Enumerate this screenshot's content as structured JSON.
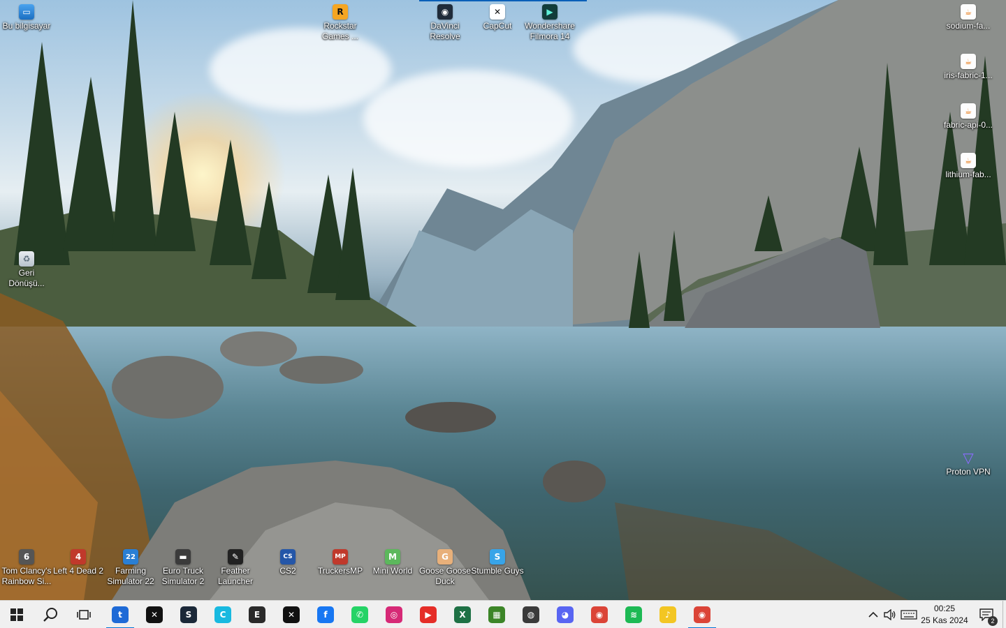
{
  "desktop": {
    "left_icons": [
      {
        "label": "Bu bilgisayar",
        "icon": "computer-icon"
      },
      {
        "label": "Geri Dönüşü...",
        "icon": "recycle-bin-icon"
      }
    ],
    "top_icons": [
      {
        "label": "Rockstar Games ...",
        "icon": "rockstar-icon",
        "color": "#f5a623",
        "glyph": "R"
      },
      {
        "label": "DaVinci Resolve",
        "icon": "davinci-resolve-icon",
        "color": "#1f2b3a",
        "glyph": "◉"
      },
      {
        "label": "CapCut",
        "icon": "capcut-icon",
        "color": "#111111",
        "glyph": "✕"
      },
      {
        "label": "Wondershare Filmora 14",
        "icon": "filmora-icon",
        "color": "#123c3a",
        "glyph": "▶"
      }
    ],
    "right_icons": [
      {
        "label": "sodium-fa...",
        "icon": "java-file-icon"
      },
      {
        "label": "iris-fabric-1...",
        "icon": "java-file-icon"
      },
      {
        "label": "fabric-api-0...",
        "icon": "java-file-icon"
      },
      {
        "label": "lithium-fab...",
        "icon": "java-file-icon"
      }
    ],
    "proton": {
      "label": "Proton VPN",
      "icon": "proton-vpn-icon",
      "color": "#6d4aff",
      "glyph": "▽"
    },
    "bottom_icons": [
      {
        "label": "Tom Clancy's Rainbow Si...",
        "icon": "rainbow-six-icon",
        "color": "#555555",
        "glyph": "6"
      },
      {
        "label": "Left 4 Dead 2",
        "icon": "left4dead2-icon",
        "color": "#c0392b",
        "glyph": "4"
      },
      {
        "label": "Farming Simulator 22",
        "icon": "farming-simulator-icon",
        "color": "#2a7fd4",
        "glyph": "22"
      },
      {
        "label": "Euro Truck Simulator 2",
        "icon": "euro-truck-icon",
        "color": "#3b3b3b",
        "glyph": "▬"
      },
      {
        "label": "Feather Launcher",
        "icon": "feather-launcher-icon",
        "color": "#222222",
        "glyph": "✎"
      },
      {
        "label": "CS2",
        "icon": "cs2-icon",
        "color": "#2456a8",
        "glyph": "CS"
      },
      {
        "label": "TruckersMP",
        "icon": "truckersmp-icon",
        "color": "#c0392b",
        "glyph": "MP"
      },
      {
        "label": "Mini World",
        "icon": "mini-world-icon",
        "color": "#5cb85c",
        "glyph": "M"
      },
      {
        "label": "Goose Goose Duck",
        "icon": "goose-goose-duck-icon",
        "color": "#e8b07a",
        "glyph": "G"
      },
      {
        "label": "Stumble Guys",
        "icon": "stumble-guys-icon",
        "color": "#38a4e8",
        "glyph": "S"
      }
    ]
  },
  "taskbar": {
    "start": {
      "icon": "windows-start-icon"
    },
    "search": {
      "icon": "search-icon"
    },
    "task_view": {
      "icon": "task-view-icon"
    },
    "apps": [
      {
        "name": "tlauncher-icon",
        "color": "#1e6ad6",
        "glyph": "t",
        "running": true
      },
      {
        "name": "capcut-icon",
        "color": "#111111",
        "glyph": "✕",
        "running": false
      },
      {
        "name": "steam-icon",
        "color": "#1b2838",
        "glyph": "S",
        "running": false
      },
      {
        "name": "canva-icon",
        "color": "#18b9e0",
        "glyph": "C",
        "running": false
      },
      {
        "name": "epic-games-icon",
        "color": "#2a2a2a",
        "glyph": "E",
        "running": false
      },
      {
        "name": "capcut-alt-icon",
        "color": "#111111",
        "glyph": "✕",
        "running": false
      },
      {
        "name": "facebook-icon",
        "color": "#1877f2",
        "glyph": "f",
        "running": false
      },
      {
        "name": "whatsapp-icon",
        "color": "#25d366",
        "glyph": "✆",
        "running": false
      },
      {
        "name": "instagram-icon",
        "color": "#d62976",
        "glyph": "◎",
        "running": false
      },
      {
        "name": "youtube-icon",
        "color": "#e52d27",
        "glyph": "▶",
        "running": false
      },
      {
        "name": "excel-icon",
        "color": "#1e7145",
        "glyph": "X",
        "running": false
      },
      {
        "name": "minecraft-icon",
        "color": "#3c8527",
        "glyph": "▦",
        "running": false
      },
      {
        "name": "obs-icon",
        "color": "#3a3a3a",
        "glyph": "◍",
        "running": false
      },
      {
        "name": "discord-icon",
        "color": "#5865f2",
        "glyph": "◕",
        "running": false
      },
      {
        "name": "chrome-icon",
        "color": "#db4437",
        "glyph": "◉",
        "running": false
      },
      {
        "name": "spotify-icon",
        "color": "#1db954",
        "glyph": "≋",
        "running": false
      },
      {
        "name": "karaoke-icon",
        "color": "#f3c623",
        "glyph": "♪",
        "running": false
      },
      {
        "name": "chrome-profile-icon",
        "color": "#db4437",
        "glyph": "◉",
        "running": true
      }
    ],
    "tray": {
      "chevron_icon": "chevron-up-icon",
      "volume_icon": "volume-icon",
      "keyboard_icon": "keyboard-icon",
      "time": "00:25",
      "date": "25 Kas 2024",
      "notifications_icon": "notification-icon",
      "notification_count": "2"
    }
  }
}
